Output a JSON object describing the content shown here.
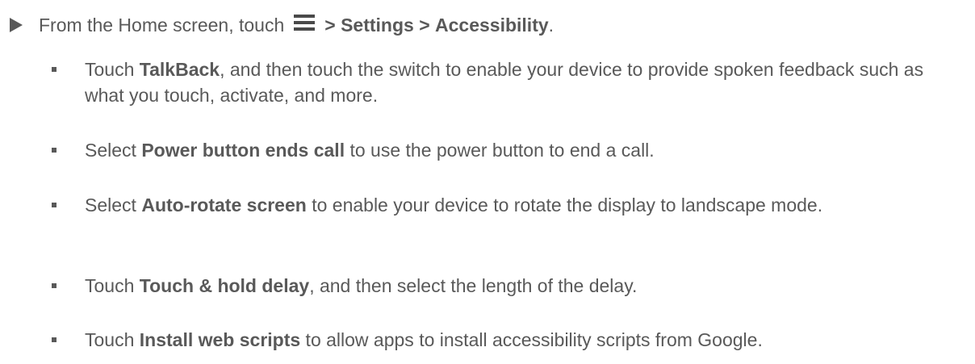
{
  "step": {
    "prefix": "From the Home screen, touch",
    "icon": "menu-icon",
    "sep1": ">",
    "settings": "Settings",
    "sep2": ">",
    "accessibility": "Accessibility",
    "suffix": "."
  },
  "items": [
    {
      "pre": "Touch ",
      "bold": "TalkBack",
      "post": ", and then touch the switch to enable your device to provide spoken feedback such as what you touch, activate, and more."
    },
    {
      "pre": "Select ",
      "bold": "Power button ends call",
      "post": " to use the power button to end a call."
    },
    {
      "pre": "Select ",
      "bold": "Auto-rotate screen",
      "post": " to enable your device to rotate the display to landscape mode."
    },
    {
      "pre": "Touch ",
      "bold": "Touch & hold delay",
      "post": ", and then select the length of the delay."
    },
    {
      "pre": "Touch ",
      "bold": "Install web scripts",
      "post": " to allow apps to install accessibility scripts from Google."
    }
  ]
}
